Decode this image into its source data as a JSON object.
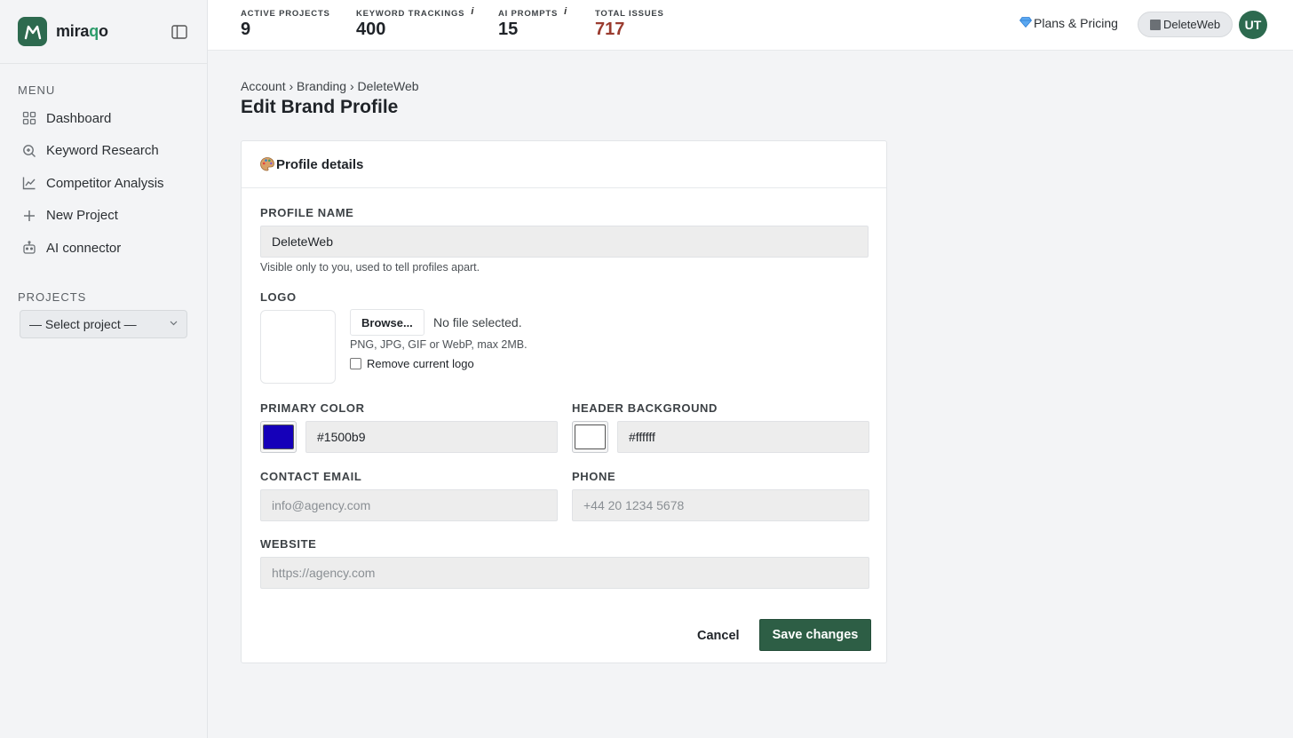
{
  "app": {
    "brand_pre": "mira",
    "brand_q": "q",
    "brand_post": "o",
    "logo_icon": "mountain-m-icon"
  },
  "sidebar": {
    "menu_label": "MENU",
    "items": [
      {
        "label": "Dashboard",
        "icon": "grid-icon"
      },
      {
        "label": "Keyword Research",
        "icon": "search-icon"
      },
      {
        "label": "Competitor Analysis",
        "icon": "chart-line-icon"
      },
      {
        "label": "New Project",
        "icon": "plus-icon"
      },
      {
        "label": "AI connector",
        "icon": "robot-icon"
      }
    ],
    "projects_label": "PROJECTS",
    "project_select": "— Select project —"
  },
  "topbar": {
    "stats": [
      {
        "label": "ACTIVE PROJECTS",
        "value": "9",
        "info": ""
      },
      {
        "label": "KEYWORD TRACKINGS",
        "value": "400",
        "info": "i"
      },
      {
        "label": "AI PROMPTS",
        "value": "15",
        "info": "i"
      },
      {
        "label": "TOTAL ISSUES",
        "value": "717",
        "info": ""
      }
    ],
    "plans_label": "Plans & Pricing",
    "workspace_label": "DeleteWeb",
    "avatar_initials": "UT",
    "colors": {
      "issues": "#9a3b2f",
      "accent": "#2d6a4f"
    }
  },
  "breadcrumb": {
    "items": [
      "Account",
      "Branding",
      "DeleteWeb"
    ],
    "sep": " › "
  },
  "page": {
    "title": "Edit Brand Profile"
  },
  "card": {
    "title": "Profile details",
    "profile_name": {
      "label": "PROFILE NAME",
      "value": "DeleteWeb",
      "hint": "Visible only to you, used to tell profiles apart."
    },
    "logo": {
      "label": "LOGO",
      "browse": "Browse...",
      "no_file": "No file selected.",
      "hint": "PNG, JPG, GIF or WebP, max 2MB.",
      "remove_label": "Remove current logo"
    },
    "primary_color": {
      "label": "PRIMARY COLOR",
      "value": "#1500b9",
      "swatch": "#1500b9"
    },
    "header_background": {
      "label": "HEADER BACKGROUND",
      "value": "#ffffff",
      "swatch": "#ffffff"
    },
    "contact_email": {
      "label": "CONTACT EMAIL",
      "placeholder": "info@agency.com"
    },
    "phone": {
      "label": "PHONE",
      "placeholder": "+44 20 1234 5678"
    },
    "website": {
      "label": "WEBSITE",
      "placeholder": "https://agency.com"
    },
    "cancel": "Cancel",
    "save": "Save changes",
    "save_color": "#2d5e45"
  }
}
